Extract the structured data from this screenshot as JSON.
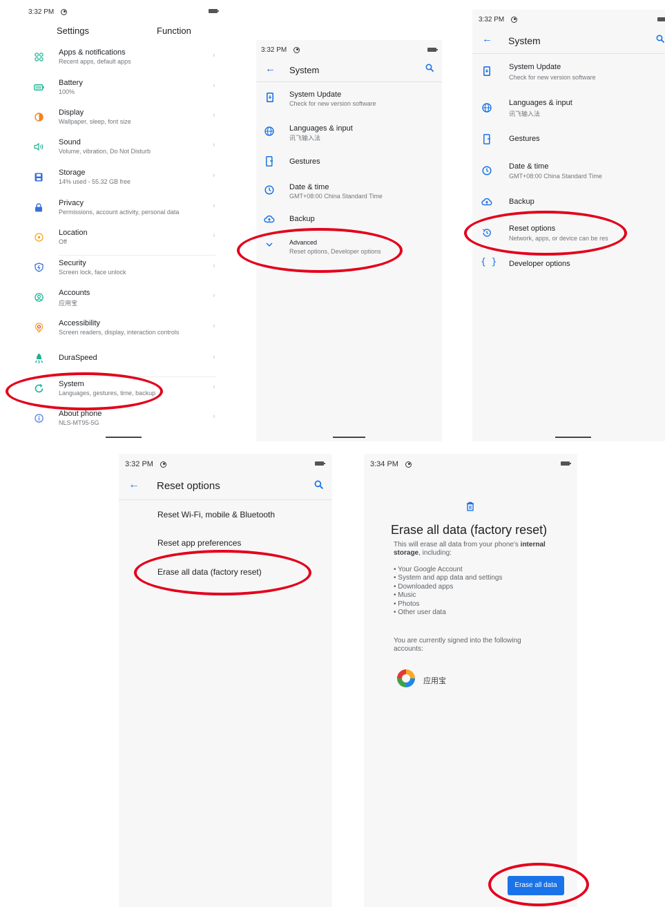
{
  "panel1": {
    "time": "3:32 PM",
    "tabs": [
      "Settings",
      "Function"
    ],
    "items": [
      {
        "title": "Apps & notifications",
        "subtitle": "Recent apps, default apps",
        "icon": "apps-icon",
        "color": "#1ab394"
      },
      {
        "title": "Battery",
        "subtitle": "100%",
        "icon": "battery-icon",
        "color": "#1ab394"
      },
      {
        "title": "Display",
        "subtitle": "Wallpaper, sleep, font size",
        "icon": "display-icon",
        "color": "#f58220"
      },
      {
        "title": "Sound",
        "subtitle": "Volume, vibration, Do Not Disturb",
        "icon": "sound-icon",
        "color": "#1ab394"
      },
      {
        "title": "Storage",
        "subtitle": "14% used - 55.32 GB free",
        "icon": "storage-icon",
        "color": "#3a6fd8"
      },
      {
        "title": "Privacy",
        "subtitle": "Permissions, account activity, personal data",
        "icon": "privacy-icon",
        "color": "#3a6fd8"
      },
      {
        "title": "Location",
        "subtitle": "Off",
        "icon": "location-icon",
        "color": "#f5a623"
      },
      {
        "title": "Security",
        "subtitle": "Screen lock, face unlock",
        "icon": "security-icon",
        "color": "#3a6fd8"
      },
      {
        "title": "Accounts",
        "subtitle": "应用宝",
        "icon": "accounts-icon",
        "color": "#1ab394"
      },
      {
        "title": "Accessibility",
        "subtitle": "Screen readers, display, interaction controls",
        "icon": "accessibility-icon",
        "color": "#f5a623"
      },
      {
        "title": "DuraSpeed",
        "subtitle": "",
        "icon": "duraspeed-icon",
        "color": "#1ab394"
      },
      {
        "title": "System",
        "subtitle": "Languages, gestures, time, backup",
        "icon": "system-icon",
        "color": "#1ab394"
      },
      {
        "title": "About phone",
        "subtitle": "NLS-MT95-5G",
        "icon": "info-icon",
        "color": "#3a6fd8"
      }
    ]
  },
  "panel2": {
    "time": "3:32 PM",
    "title": "System",
    "items": [
      {
        "title": "System Update",
        "subtitle": "Check for new version software"
      },
      {
        "title": "Languages & input",
        "subtitle": "讯飞输入法"
      },
      {
        "title": "Gestures",
        "subtitle": ""
      },
      {
        "title": "Date & time",
        "subtitle": "GMT+08:00 China Standard Time"
      },
      {
        "title": "Backup",
        "subtitle": ""
      },
      {
        "title": "Advanced",
        "subtitle": "Reset options, Developer options"
      }
    ]
  },
  "panel3": {
    "time": "3:32 PM",
    "title": "System",
    "items": [
      {
        "title": "System Update",
        "subtitle": "Check for new version software"
      },
      {
        "title": "Languages & input",
        "subtitle": "讯飞输入法"
      },
      {
        "title": "Gestures",
        "subtitle": ""
      },
      {
        "title": "Date & time",
        "subtitle": "GMT+08:00 China Standard Time"
      },
      {
        "title": "Backup",
        "subtitle": ""
      },
      {
        "title": "Reset options",
        "subtitle": "Network, apps, or device can be res"
      },
      {
        "title": "Developer options",
        "subtitle": ""
      }
    ]
  },
  "panel4": {
    "time": "3:32 PM",
    "title": "Reset options",
    "items": [
      "Reset Wi-Fi, mobile & Bluetooth",
      "Reset app preferences",
      "Erase all data (factory reset)"
    ]
  },
  "panel5": {
    "time": "3:34 PM",
    "heading": "Erase all data (factory reset)",
    "intro_prefix": "This will erase all data from your phone's",
    "intro_bold1": "internal",
    "intro_bold2": "storage",
    "intro_suffix": ", including:",
    "bullets": [
      "Your Google Account",
      "System and app data and settings",
      "Downloaded apps",
      "Music",
      "Photos",
      "Other user data"
    ],
    "signed_in_text": "You are currently signed into the following accounts:",
    "account_name": "应用宝",
    "button_label": "Erase all data"
  },
  "colors": {
    "accent": "#1a73e8",
    "highlight": "#e3001b"
  }
}
